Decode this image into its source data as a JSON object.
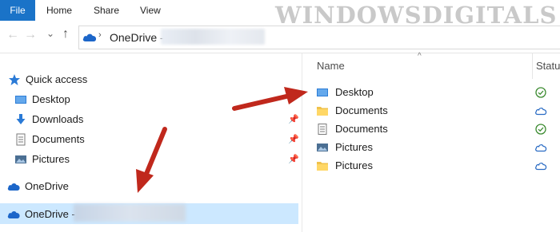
{
  "ribbon": {
    "tabs": [
      {
        "label": "File"
      },
      {
        "label": "Home"
      },
      {
        "label": "Share"
      },
      {
        "label": "View"
      }
    ]
  },
  "watermark": "WINDOWSDIGITALS",
  "address_bar": {
    "path": "OneDrive -"
  },
  "nav_pane": {
    "quick_access_label": "Quick access",
    "quick_access_items": [
      {
        "label": "Desktop",
        "icon": "desktop-icon",
        "pinned": false
      },
      {
        "label": "Downloads",
        "icon": "downloads-icon",
        "pinned": true
      },
      {
        "label": "Documents",
        "icon": "documents-icon",
        "pinned": true
      },
      {
        "label": "Pictures",
        "icon": "pictures-icon",
        "pinned": true
      }
    ],
    "onedrive_personal_label": "OneDrive",
    "onedrive_business_label": "OneDrive -"
  },
  "content": {
    "columns": {
      "name": "Name",
      "status": "Status"
    },
    "files": [
      {
        "name": "Desktop",
        "icon": "desktop-icon",
        "status": "synced"
      },
      {
        "name": "Documents",
        "icon": "folder-icon",
        "status": "cloud"
      },
      {
        "name": "Documents",
        "icon": "documents-icon",
        "status": "synced"
      },
      {
        "name": "Pictures",
        "icon": "pictures-icon",
        "status": "cloud"
      },
      {
        "name": "Pictures",
        "icon": "folder-icon",
        "status": "cloud"
      }
    ]
  },
  "colors": {
    "accent": "#1a73c8",
    "selection": "#cce8ff",
    "arrow": "#c0281c",
    "synced": "#3a8a2f",
    "cloud": "#2b6cc4"
  }
}
